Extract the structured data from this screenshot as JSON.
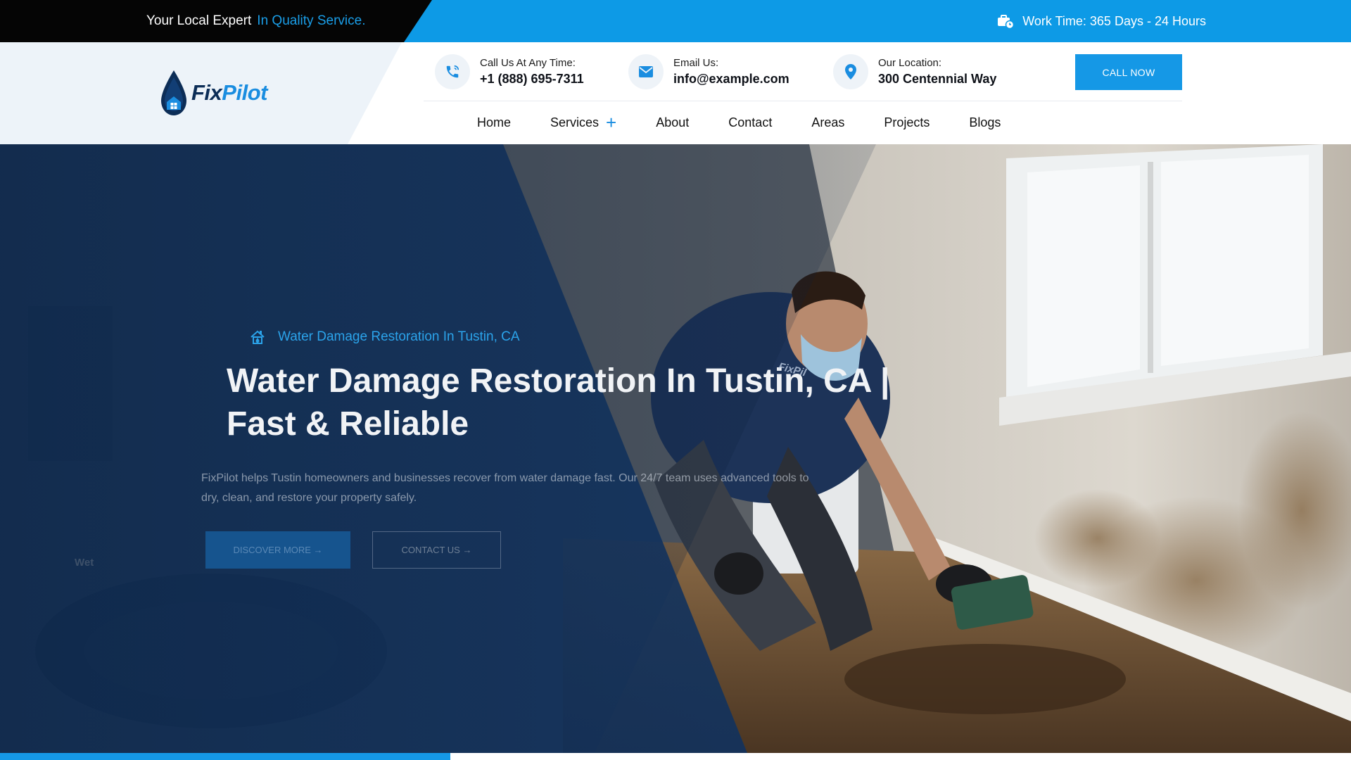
{
  "topbar": {
    "tagline_white": "Your Local Expert",
    "tagline_blue": "In Quality Service.",
    "work_time": "Work Time: 365 Days - 24 Hours",
    "work_time_icon": "briefcase-clock-icon"
  },
  "brand": {
    "name_part1": "Fix",
    "name_part2": "Pilot",
    "icon": "water-drop-house-icon"
  },
  "contacts": [
    {
      "label": "Call Us At Any Time:",
      "value": "+1 (888) 695-7311",
      "icon": "phone-icon"
    },
    {
      "label": "Email Us:",
      "value": "info@example.com",
      "icon": "envelope-icon"
    },
    {
      "label": "Our Location:",
      "value": "300 Centennial Way",
      "icon": "map-pin-icon"
    }
  ],
  "call_button": "CALL NOW",
  "nav": {
    "items": [
      "Home",
      "Services",
      "About",
      "Contact",
      "Areas",
      "Projects",
      "Blogs"
    ],
    "services_expand": "+"
  },
  "hero": {
    "subheading": "Water Damage Restoration In Tustin, CA",
    "subheading_icon": "house-water-icon",
    "title_line1": "Water Damage Restoration In Tustin, CA |",
    "title_line2": "Fast & Reliable",
    "description": "FixPilot helps Tustin homeowners and businesses recover from water damage fast. Our 24/7 team uses advanced tools to dry, clean, and restore your property safely.",
    "discover_button": "DISCOVER MORE →",
    "contact_button": "CONTACT US →",
    "shirt_logo_text": "FixPil",
    "machine_text": "Wet"
  },
  "colors": {
    "accent": "#1598e6",
    "dark": "#050505",
    "navy": "#0c2d57",
    "overlay": "#0f2a4e"
  }
}
